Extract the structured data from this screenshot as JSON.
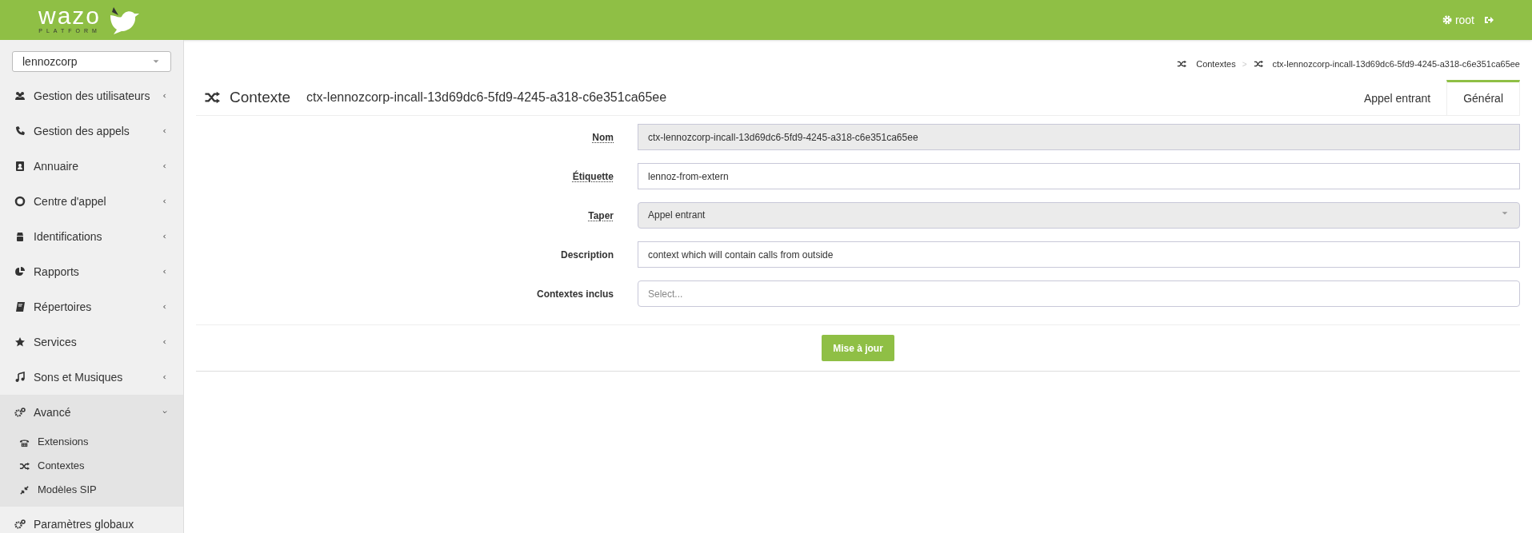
{
  "header": {
    "logo_text": "wazo",
    "logo_subtext": "PLATFORM",
    "user": "root"
  },
  "sidebar": {
    "tenant_select": "lennozcorp",
    "items": [
      {
        "label": "Gestion des utilisateurs",
        "kind": "group",
        "expanded": false
      },
      {
        "label": "Gestion des appels",
        "kind": "group",
        "expanded": false
      },
      {
        "label": "Annuaire",
        "kind": "group",
        "expanded": false
      },
      {
        "label": "Centre d'appel",
        "kind": "group",
        "expanded": false
      },
      {
        "label": "Identifications",
        "kind": "group",
        "expanded": false
      },
      {
        "label": "Rapports",
        "kind": "group",
        "expanded": false
      },
      {
        "label": "Répertoires",
        "kind": "group",
        "expanded": false
      },
      {
        "label": "Services",
        "kind": "group",
        "expanded": false
      },
      {
        "label": "Sons et Musiques",
        "kind": "group",
        "expanded": false
      },
      {
        "label": "Avancé",
        "kind": "group",
        "expanded": true,
        "children": [
          {
            "label": "Extensions"
          },
          {
            "label": "Contextes"
          },
          {
            "label": "Modèles SIP"
          }
        ]
      },
      {
        "label": "Paramètres globaux",
        "kind": "link",
        "expanded": false
      }
    ]
  },
  "breadcrumb": [
    "Contextes",
    "ctx-lennozcorp-incall-13d69dc6-5fd9-4245-a318-c6e351ca65ee"
  ],
  "breadcrumb_separator": ">",
  "page": {
    "title": "Contexte",
    "subtitle": "ctx-lennozcorp-incall-13d69dc6-5fd9-4245-a318-c6e351ca65ee"
  },
  "tabs": [
    {
      "label": "Appel entrant",
      "selected": false
    },
    {
      "label": "Général",
      "selected": true
    }
  ],
  "form": {
    "fields": [
      {
        "label": "Nom",
        "hint": true,
        "kind": "text",
        "disabled": true,
        "value": "ctx-lennozcorp-incall-13d69dc6-5fd9-4245-a318-c6e351ca65ee"
      },
      {
        "label": "Étiquette",
        "hint": true,
        "kind": "text",
        "disabled": false,
        "value": "lennoz-from-extern"
      },
      {
        "label": "Taper",
        "hint": true,
        "kind": "select",
        "disabled": true,
        "value": "Appel entrant"
      },
      {
        "label": "Description",
        "hint": false,
        "kind": "text",
        "disabled": false,
        "value": "context which will contain calls from outside"
      },
      {
        "label": "Contextes inclus",
        "hint": false,
        "kind": "multiselect",
        "disabled": false,
        "placeholder": "Select..."
      }
    ],
    "submit": "Mise à jour"
  }
}
